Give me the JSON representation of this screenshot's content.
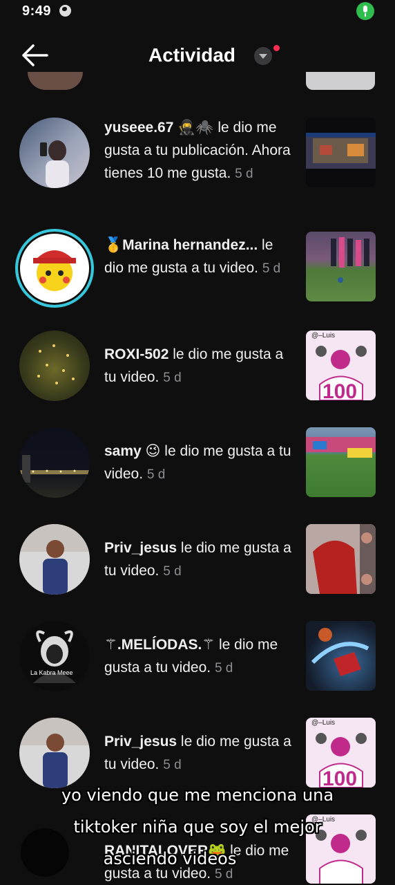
{
  "status_bar": {
    "time": "9:49"
  },
  "header": {
    "title": "Actividad"
  },
  "notifications": [
    {
      "username": "yuseee.67 🥷🕷️",
      "message": " le dio me gusta a tu publicación. Ahora tienes 10 me gusta.",
      "time": "5 d"
    },
    {
      "username": "🥇Marina hernandez...",
      "message": " le dio me gusta a tu video.",
      "time": "5 d"
    },
    {
      "username": "ROXI-502",
      "message": " le dio me gusta a tu video.",
      "time": "5 d"
    },
    {
      "username": "samy 😉",
      "message": " le dio me gusta a tu video.",
      "time": "5 d"
    },
    {
      "username": "Priv_jesus",
      "message": " le dio me gusta a tu video.",
      "time": "5 d"
    },
    {
      "username": "⚚.MELÍODAS.⚚",
      "message": " le dio me gusta a tu video.",
      "time": "5 d"
    },
    {
      "username": "Priv_jesus",
      "message": " le dio me gusta a tu video.",
      "time": "5 d"
    },
    {
      "username": "RANITALOVER🐸",
      "message": " le dio me gusta a tu video.",
      "time": "5 d"
    }
  ],
  "thumb_labels": {
    "luis_1": "@–Luis",
    "luis_2": "@–Luis",
    "luis_3": "@–Luis",
    "hundred": "100"
  },
  "avatar_labels": {
    "kabra": "La Kabra Meee"
  },
  "caption_lines": [
    "yo viendo que me menciona una",
    "tiktoker niña que soy el mejor",
    "asciendo videos"
  ],
  "icons": {
    "back": "arrow-left-icon",
    "dropdown": "chevron-down-icon",
    "mic": "microphone-indicator-icon",
    "globe": "globe-icon"
  },
  "colors": {
    "background": "#0f0f10",
    "accent_red": "#fe2c55",
    "ring_cyan": "#35c8dd",
    "timestamp_gray": "#8e8e93",
    "mic_green": "#2fbd4f"
  }
}
